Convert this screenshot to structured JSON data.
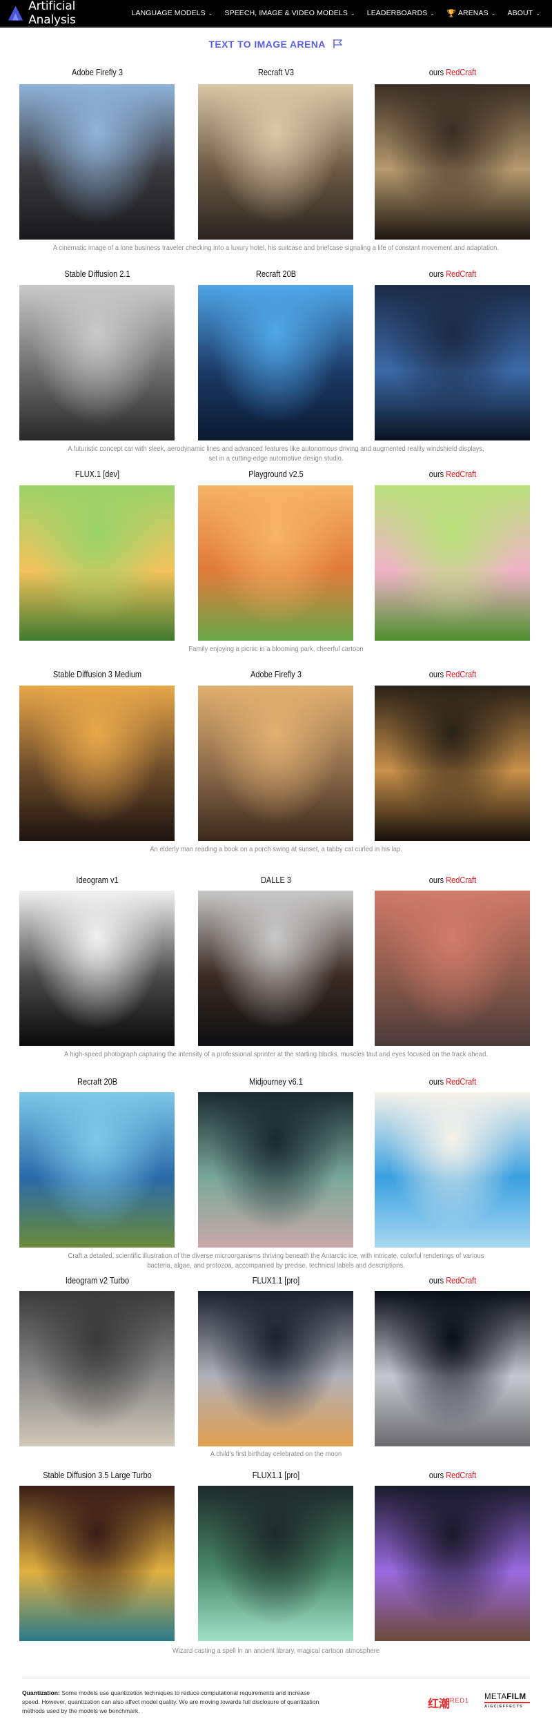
{
  "navbar": {
    "brand": "Artificial Analysis",
    "items": [
      {
        "label": "LANGUAGE MODELS",
        "icon": "chevron-down-icon"
      },
      {
        "label": "SPEECH, IMAGE & VIDEO MODELS",
        "icon": "chevron-down-icon"
      },
      {
        "label": "LEADERBOARDS",
        "icon": "chevron-down-icon"
      },
      {
        "label": "ARENAS",
        "icon": "chevron-down-icon",
        "prefix_icon": "trophy-icon"
      },
      {
        "label": "ABOUT",
        "icon": "chevron-down-icon"
      }
    ],
    "chevron": "⌄",
    "trophy": "🏆"
  },
  "page": {
    "title": "TEXT TO IMAGE ARENA",
    "title_icon": "flag-icon",
    "accent_color": "#5b5ee6",
    "highlight_color": "#e8141b"
  },
  "comparisons": [
    {
      "models": [
        "Adobe Firefly 3",
        "Recraft V3",
        "RedCraft"
      ],
      "prompt": "A cinematic image of a lone business traveler checking into a luxury hotel, his suitcase and briefcase signaling a life of constant movement and adaptation."
    },
    {
      "models": [
        "Stable Diffusion 2.1",
        "Recraft 20B",
        "RedCraft"
      ],
      "prompt": "A futuristic concept car with sleek, aerodynamic lines and advanced features like autonomous driving and augmented reality windshield displays, set in a cutting-edge automotive design studio."
    },
    {
      "models": [
        "FLUX.1 [dev]",
        "Playground v2.5",
        "RedCraft"
      ],
      "prompt": "Family enjoying a picnic in a blooming park, cheerful cartoon"
    },
    {
      "models": [
        "Stable Diffusion 3 Medium",
        "Adobe Firefly 3",
        "RedCraft"
      ],
      "prompt": "An elderly man reading a book on a porch swing at sunset, a tabby cat curled in his lap."
    },
    {
      "models": [
        "Ideogram v1",
        "DALLE 3",
        "RedCraft"
      ],
      "prompt": "A high-speed photograph capturing the intensity of a professional sprinter at the starting blocks, muscles taut and eyes focused on the track ahead."
    },
    {
      "models": [
        "Recraft 20B",
        "Midjourney v6.1",
        "RedCraft"
      ],
      "prompt": "Craft a detailed, scientific illustration of the diverse microorganisms thriving beneath the Antarctic ice, with intricate, colorful renderings of various bacteria, algae, and protozoa, accompanied by precise, technical labels and descriptions."
    },
    {
      "models": [
        "Ideogram v2 Turbo",
        "FLUX1.1 [pro]",
        "RedCraft"
      ],
      "prompt": "A child's first birthday celebrated on the moon"
    },
    {
      "models": [
        "Stable Diffusion 3.5 Large Turbo",
        "FLUX1.1 [pro]",
        "RedCraft"
      ],
      "prompt": "Wizard casting a spell in an ancient library, magical cartoon atmosphere"
    }
  ],
  "ours_prefix": "ours",
  "footer": {
    "quantization_label": "Quantization:",
    "quantization_text": "Some models use quantization techniques to reduce computational requirements and increase speed. However, quantization can also affect model quality. We are moving towards full disclosure of quantization methods used by the models we benchmark.",
    "logo_red1_cn": "红潮",
    "logo_red1_en": "RED1",
    "logo_metafilm_a": "META",
    "logo_metafilm_b": "FILM",
    "logo_metafilm_sub": "AIGC|EFFECTS"
  }
}
